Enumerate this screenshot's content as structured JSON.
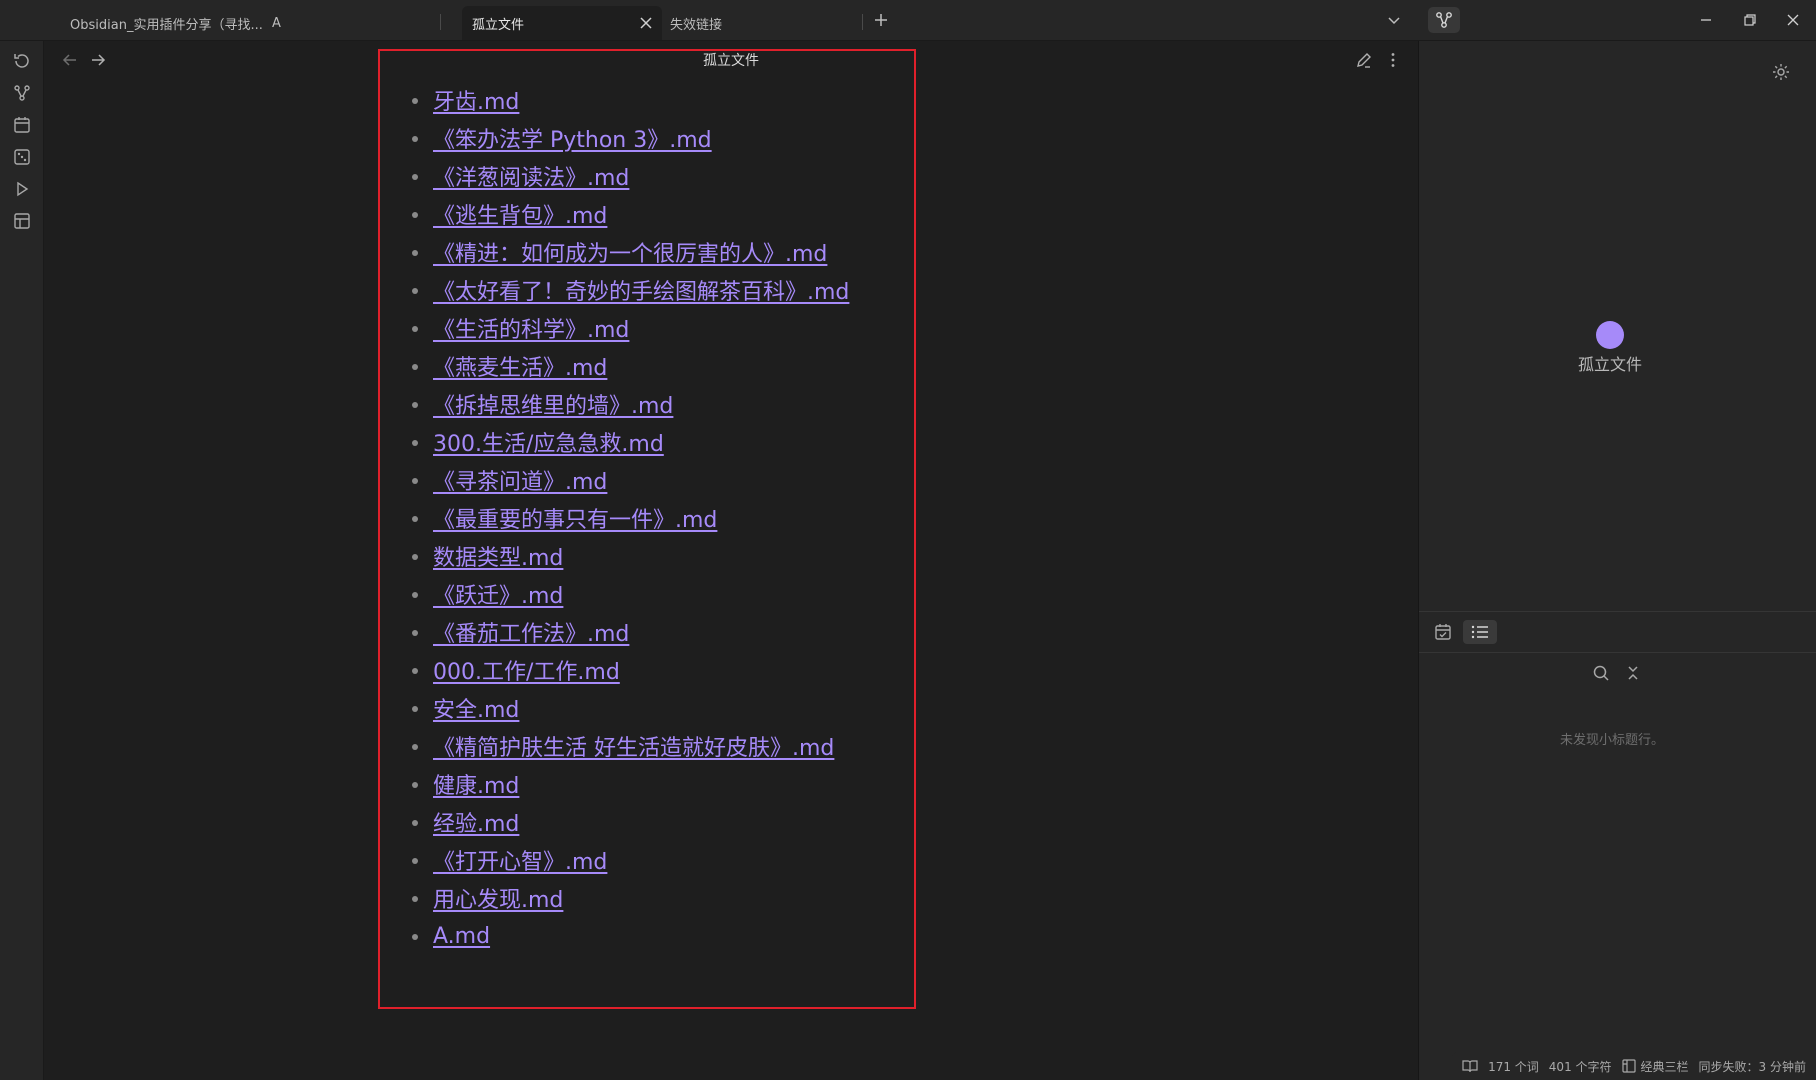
{
  "tabs": [
    {
      "label": "Obsidian_实用插件分享（寻找...",
      "suffix": "A",
      "active": false
    },
    {
      "label": "孤立文件",
      "active": true
    },
    {
      "label": "失效链接",
      "active": false
    }
  ],
  "view": {
    "title": "孤立文件",
    "files": [
      "牙齿.md",
      "《笨办法学 Python 3》.md",
      "《洋葱阅读法》.md",
      "《逃生背包》.md",
      "《精进：如何成为一个很厉害的人》.md",
      "《太好看了！奇妙的手绘图解茶百科》.md",
      "《生活的科学》.md",
      "《燕麦生活》.md",
      "《拆掉思维里的墙》.md",
      "300.生活/应急急救.md",
      "《寻茶问道》.md",
      "《最重要的事只有一件》.md",
      "数据类型.md",
      "《跃迁》.md",
      "《番茄工作法》.md",
      "000.工作/工作.md",
      "安全.md",
      "《精简护肤生活 好生活造就好皮肤》.md",
      "健康.md",
      "经验.md",
      "《打开心智》.md",
      "用心发现.md",
      "A.md"
    ]
  },
  "graph": {
    "node_label": "孤立文件",
    "node_color": "#a68af9"
  },
  "outline": {
    "empty_text": "未发现小标题行。"
  },
  "status": {
    "words": "171 个词",
    "chars": "401 个字符",
    "layout": "经典三栏",
    "sync": "同步失败：3 分钟前"
  },
  "icons": {
    "ribbon": [
      "refresh-icon",
      "graph-view-icon",
      "calendar-icon",
      "random-note-icon",
      "play-icon",
      "template-icon"
    ]
  },
  "colors": {
    "link": "#a68af9",
    "highlight_border": "#e0202b",
    "background": "#1e1e1e",
    "panel": "#262626"
  }
}
